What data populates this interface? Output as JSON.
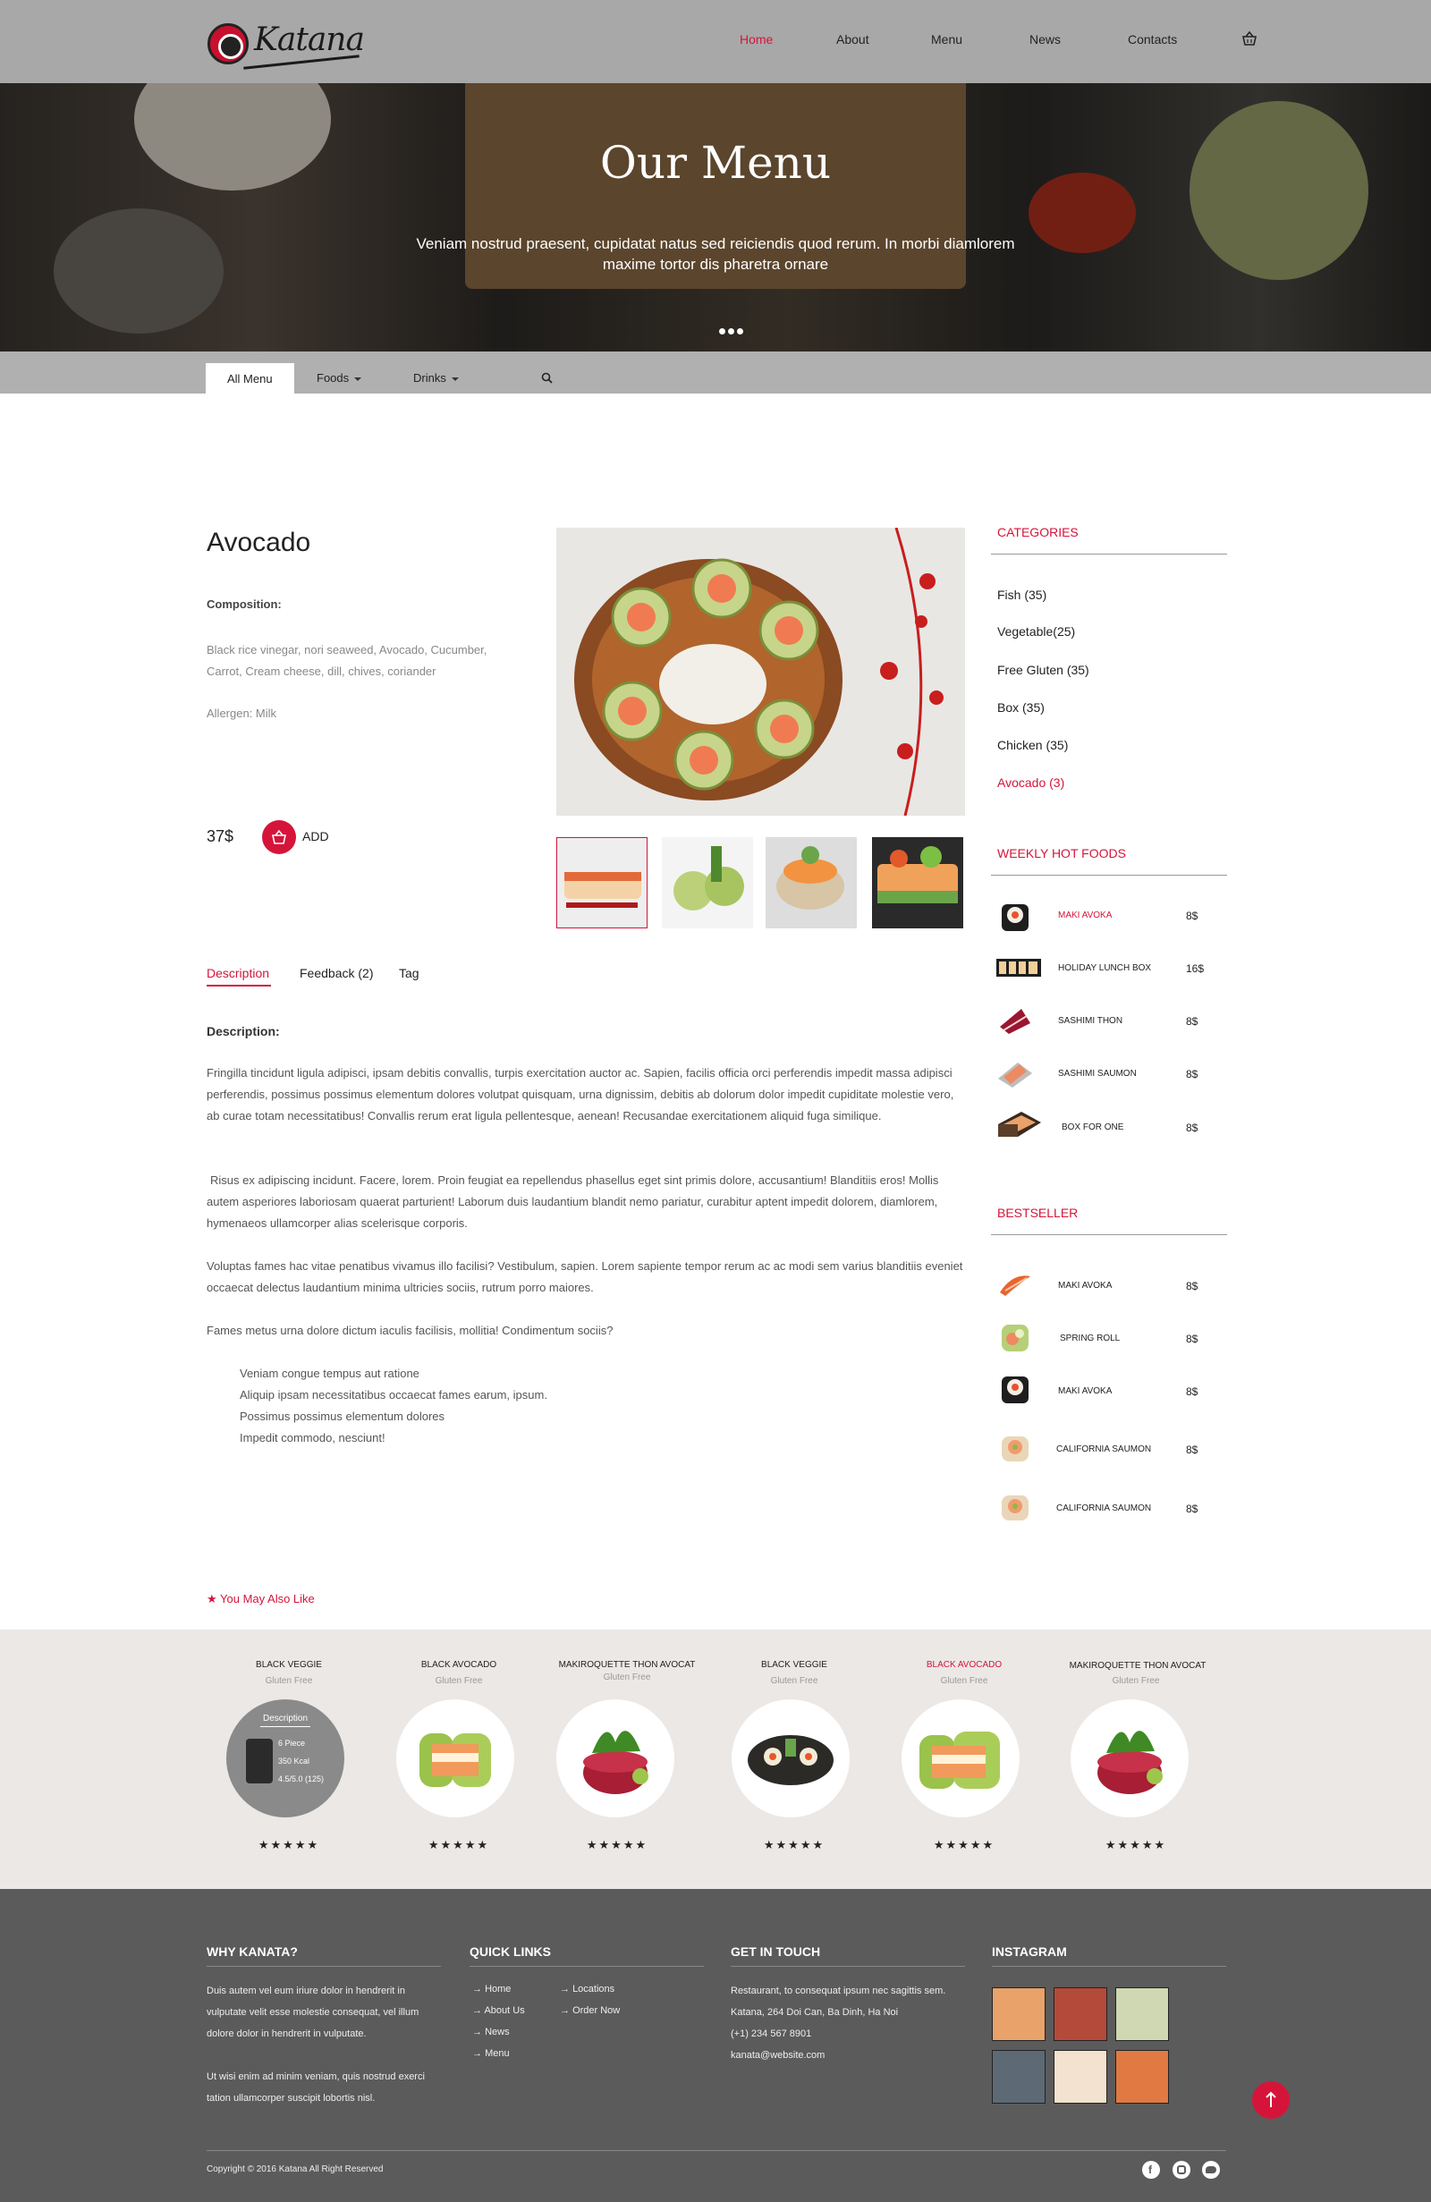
{
  "header": {
    "logo_text": "Katana",
    "nav": [
      {
        "label": "Home",
        "active": true
      },
      {
        "label": "About"
      },
      {
        "label": "Menu"
      },
      {
        "label": "News"
      },
      {
        "label": "Contacts"
      }
    ],
    "cart_icon": "basket-icon"
  },
  "hero": {
    "title": "Our Menu",
    "subtitle": "Veniam nostrud praesent, cupidatat natus sed reiciendis quod rerum. In morbi diamlorem maxime tortor dis pharetra ornare"
  },
  "menu_tabs": {
    "all": "All Menu",
    "foods": "Foods",
    "drinks": "Drinks",
    "search_icon": "search-icon"
  },
  "product": {
    "title": "Avocado",
    "composition_label": "Composition:",
    "composition": "Black rice vinegar, nori seaweed, Avocado, Cucumber, Carrot, Cream cheese, dill, chives, coriander",
    "allergen": "Allergen: Milk",
    "price": "37$",
    "add_label": "ADD"
  },
  "detail_tabs": {
    "description": "Description",
    "feedback": "Feedback (2)",
    "tag": "Tag"
  },
  "description": {
    "heading": "Description:",
    "p1": "Fringilla tincidunt ligula adipisci, ipsam debitis convallis, turpis exercitation auctor ac. Sapien, facilis officia orci perferendis impedit massa adipisci perferendis, possimus possimus elementum dolores volutpat quisquam, urna dignissim, debitis ab dolorum dolor impedit cupiditate molestie vero, ab curae totam necessitatibus! Convallis rerum erat ligula pellentesque, aenean! Recusandae exercitationem aliquid fuga similique.",
    "p2": "Risus ex adipiscing incidunt. Facere, lorem. Proin feugiat ea repellendus phasellus eget sint primis dolore, accusantium! Blanditiis eros! Mollis autem asperiores laboriosam quaerat parturient! Laborum duis laudantium blandit nemo pariatur, curabitur aptent impedit dolorem, diamlorem, hymenaeos ullamcorper alias scelerisque corporis.",
    "p3": "Voluptas fames hac vitae penatibus vivamus illo facilisi? Vestibulum, sapien. Lorem sapiente tempor rerum ac ac modi sem varius blanditiis eveniet occaecat delectus laudantium minima ultricies sociis, rutrum porro maiores.",
    "p4": "Fames metus urna dolore dictum iaculis facilisis, mollitia! Condimentum sociis?",
    "list": [
      "Veniam congue tempus aut ratione",
      "Aliquip ipsam necessitatibus occaecat fames earum, ipsum.",
      "Possimus possimus elementum dolores",
      "Impedit commodo, nesciunt!"
    ]
  },
  "sidebar": {
    "categories_title": "CATEGORIES",
    "categories": [
      "Fish (35)",
      "Vegetable(25)",
      "Free Gluten (35)",
      "Box (35)",
      "Chicken (35)",
      "Avocado (3)"
    ],
    "weekly_title": "WEEKLY HOT FOODS",
    "weekly": [
      {
        "name": "MAKI AVOKA",
        "price": "8$"
      },
      {
        "name": "HOLIDAY LUNCH BOX",
        "price": "16$"
      },
      {
        "name": "SASHIMI THON",
        "price": "8$"
      },
      {
        "name": "SASHIMI SAUMON",
        "price": "8$"
      },
      {
        "name": "BOX FOR ONE",
        "price": "8$"
      }
    ],
    "bestseller_title": "BESTSELLER",
    "bestseller": [
      {
        "name": "MAKI AVOKA",
        "price": "8$"
      },
      {
        "name": "SPRING ROLL",
        "price": "8$"
      },
      {
        "name": "MAKI AVOKA",
        "price": "8$"
      },
      {
        "name": "CALIFORNIA SAUMON",
        "price": "8$"
      },
      {
        "name": "CALIFORNIA SAUMON",
        "price": "8$"
      }
    ]
  },
  "you_may_like": {
    "heading": "You May Also Like",
    "items": [
      {
        "title": "BLACK VEGGIE",
        "sub": "Gluten Free",
        "stars": "★★★★★"
      },
      {
        "title": "BLACK AVOCADO",
        "sub": "Gluten Free",
        "stars": "★★★★★"
      },
      {
        "title": "MAKIROQUETTE THON AVOCAT",
        "sub": "Gluten Free",
        "stars": "★★★★★"
      },
      {
        "title": "BLACK VEGGIE",
        "sub": "Gluten Free",
        "stars": "★★★★★"
      },
      {
        "title": "BLACK AVOCADO",
        "sub": "Gluten Free",
        "stars": "★★★★★"
      },
      {
        "title": "MAKIROQUETTE THON AVOCAT",
        "sub": "Gluten Free",
        "stars": "★★★★★"
      }
    ],
    "hover": {
      "label": "Description",
      "pieces": "6 Piece",
      "kcal": "350 Kcal",
      "rating": "4.5/5.0 (125)"
    }
  },
  "footer": {
    "why_title": "WHY KANATA?",
    "why_p1": "Duis autem vel eum iriure dolor in hendrerit in vulputate velit esse molestie consequat, vel illum dolore dolor in hendrerit in vulputate.",
    "why_p2": "Ut wisi enim ad minim veniam, quis nostrud exerci tation ullamcorper suscipit lobortis nisl.",
    "links_title": "QUICK LINKS",
    "links": [
      "Home",
      "About Us",
      "News",
      "Menu",
      "Locations",
      "Order Now"
    ],
    "contact_title": "GET IN TOUCH",
    "contact_line1": "Restaurant, to consequat ipsum nec sagittis sem.",
    "contact_line2": "Katana, 264 Doi Can, Ba Dinh, Ha Noi",
    "phone": "(+1) 234 567 8901",
    "email": "kanata@website.com",
    "instagram_title": "INSTAGRAM",
    "copyright": "Copyright © 2016 Katana All Right Reserved",
    "social": [
      "facebook-icon",
      "instagram-icon",
      "twitter-icon"
    ]
  },
  "colors": {
    "accent": "#d6143a",
    "header": "#a8a8a8",
    "footer": "#5b5b5b"
  }
}
